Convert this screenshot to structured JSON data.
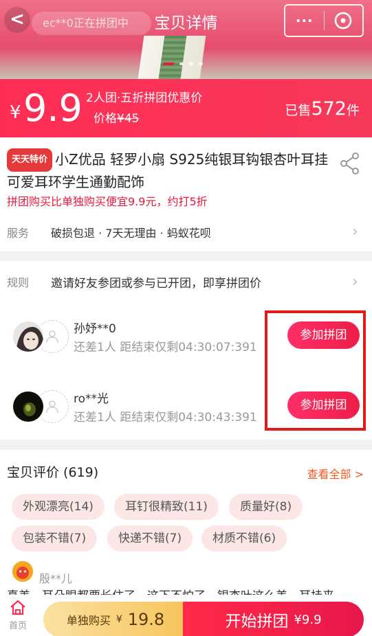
{
  "header": {
    "title": "宝贝详情",
    "notice": "ec**0正在拼团中",
    "more_label": "···"
  },
  "price": {
    "yen": "¥",
    "amount": "9.9",
    "promo": "2人团·五折拼团优惠价",
    "orig_label": "价格",
    "orig_price": "¥45",
    "sold_prefix": "已售",
    "sold_count": "572",
    "sold_suffix": "件"
  },
  "product": {
    "badge": "天天特价",
    "title": "小Z优品 轻罗小扇 S925纯银耳钩银杏叶耳挂可爱耳环学生通勤配饰",
    "subtitle": "拼团购买比单独购买便宜9.9元，约打5折",
    "service_label": "服务",
    "service_value": "破损包退 · 7天无理由 · 蚂蚁花呗"
  },
  "rules": {
    "label": "规则",
    "text": "邀请好友参团或参与已开团，即享拼团价"
  },
  "groups": [
    {
      "user": "孙妤**0",
      "info": "还差1人 距结束仅剩04:30:07:391",
      "button": "参加拼团"
    },
    {
      "user": "ro**光",
      "info": "还差1人 距结束仅剩04:30:43:391",
      "button": "参加拼团"
    }
  ],
  "reviews": {
    "title": "宝贝评价 (619)",
    "view_all": "查看全部 >",
    "tags": [
      "外观漂亮(14)",
      "耳钉很精致(11)",
      "质量好(8)",
      "包装不错(7)",
      "快递不错(7)",
      "材质不错(6)"
    ],
    "first_user": "殷**儿",
    "first_text": "真美，耳朵眼都要长住了，这下不怕了，银杏叶这么美，耳挂来"
  },
  "bottom": {
    "home_label": "首页",
    "single_label": "单独购买",
    "single_yen": "¥",
    "single_price": "19.8",
    "group_label": "开始拼团",
    "group_price": "¥9.9"
  },
  "colors": {
    "accent": "#ff2d55",
    "highlight_box": "#e41a1a",
    "single_btn": "#f7c45b"
  }
}
